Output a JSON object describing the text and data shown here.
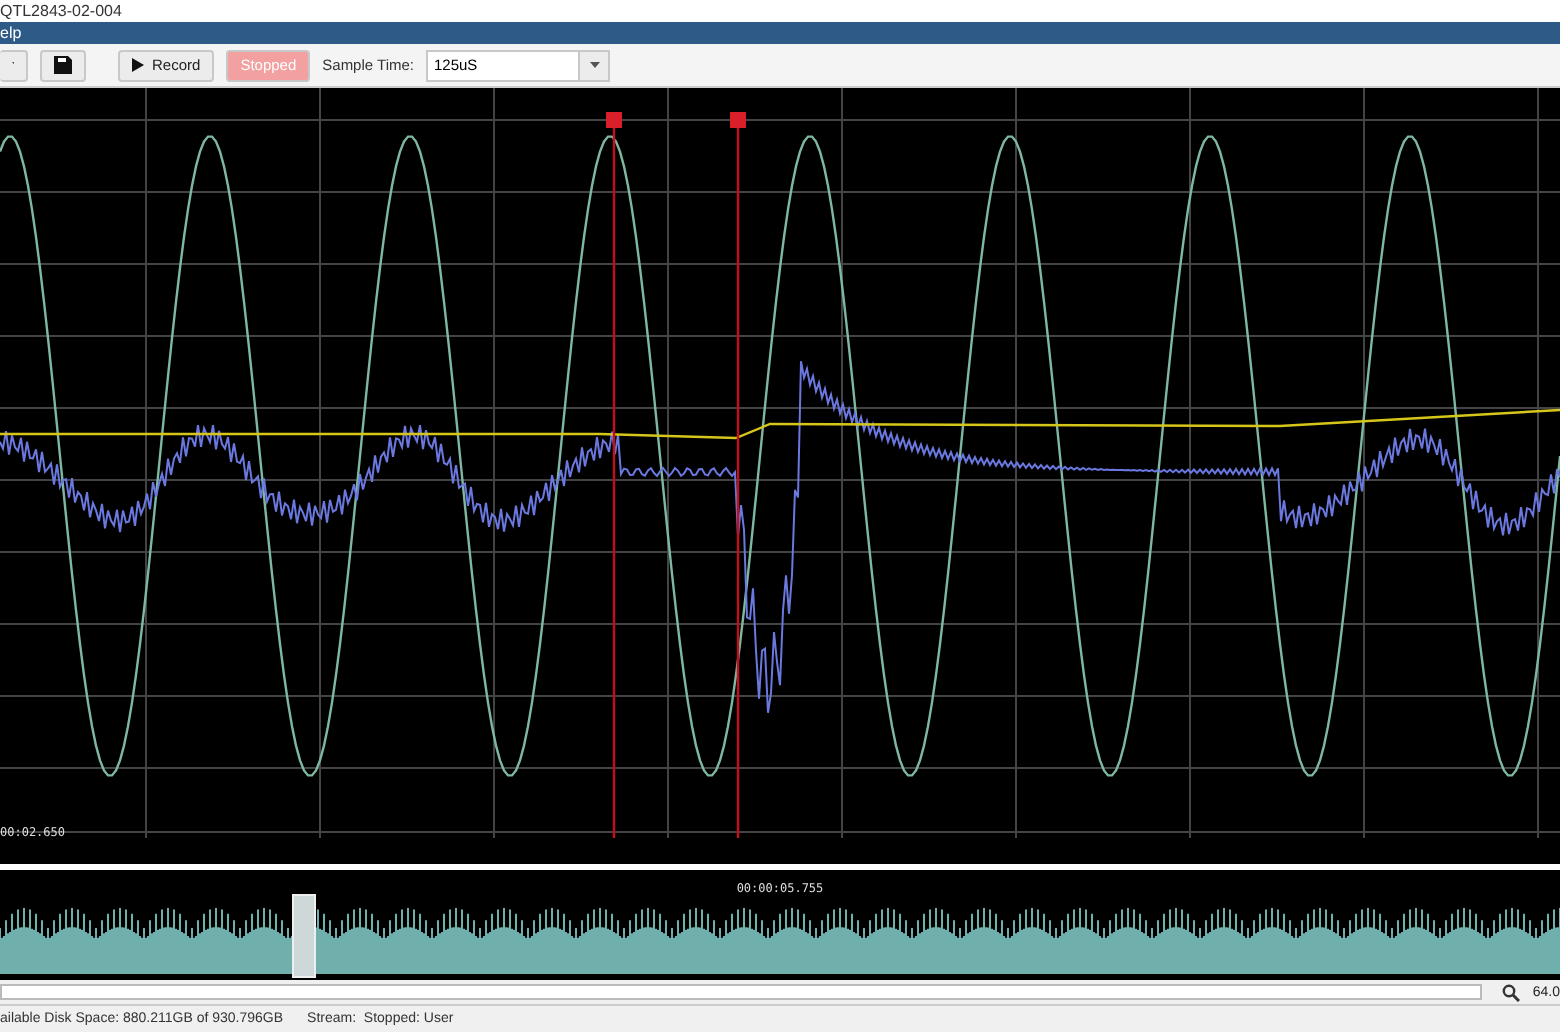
{
  "window": {
    "title": "QTL2843-02-004"
  },
  "menu": [
    {
      "label": "elp"
    }
  ],
  "toolbar": {
    "record_label": "Record",
    "stop_label": "Stopped",
    "sample_time_label": "Sample Time:",
    "sample_time_value": "125uS"
  },
  "plot": {
    "time_label": "00:02.650"
  },
  "overview": {
    "time_label": "00:00:05.755"
  },
  "zoom": {
    "value": "64.0"
  },
  "status_bar": {
    "disk_space": "ailable Disk Space: 880.211GB of 930.796GB",
    "stream": "Stream:  Stopped: User"
  }
}
